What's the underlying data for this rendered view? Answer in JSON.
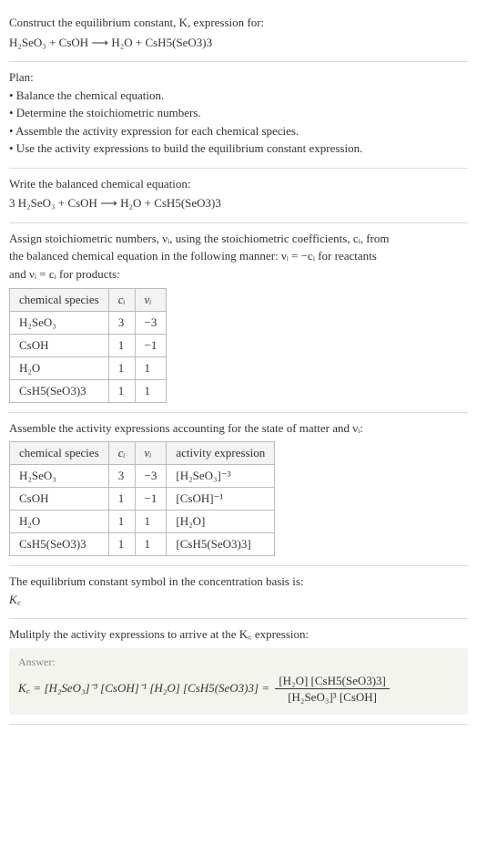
{
  "s1": {
    "title": "Construct the equilibrium constant, K, expression for:",
    "eq": "H₂SeO₃ + CsOH ⟶ H₂O + CsH5(SeO3)3"
  },
  "s2": {
    "title": "Plan:",
    "b1": "• Balance the chemical equation.",
    "b2": "• Determine the stoichiometric numbers.",
    "b3": "• Assemble the activity expression for each chemical species.",
    "b4": "• Use the activity expressions to build the equilibrium constant expression."
  },
  "s3": {
    "title": "Write the balanced chemical equation:",
    "eq": "3 H₂SeO₃ + CsOH ⟶ H₂O + CsH5(SeO3)3"
  },
  "s4": {
    "intro1": "Assign stoichiometric numbers, νᵢ, using the stoichiometric coefficients, cᵢ, from",
    "intro2": "the balanced chemical equation in the following manner: νᵢ = −cᵢ for reactants",
    "intro3": "and νᵢ = cᵢ for products:",
    "h1": "chemical species",
    "h2": "cᵢ",
    "h3": "νᵢ",
    "r1c1": "H₂SeO₃",
    "r1c2": "3",
    "r1c3": "−3",
    "r2c1": "CsOH",
    "r2c2": "1",
    "r2c3": "−1",
    "r3c1": "H₂O",
    "r3c2": "1",
    "r3c3": "1",
    "r4c1": "CsH5(SeO3)3",
    "r4c2": "1",
    "r4c3": "1"
  },
  "s5": {
    "intro": "Assemble the activity expressions accounting for the state of matter and νᵢ:",
    "h1": "chemical species",
    "h2": "cᵢ",
    "h3": "νᵢ",
    "h4": "activity expression",
    "r1c1": "H₂SeO₃",
    "r1c2": "3",
    "r1c3": "−3",
    "r1c4": "[H₂SeO₃]⁻³",
    "r2c1": "CsOH",
    "r2c2": "1",
    "r2c3": "−1",
    "r2c4": "[CsOH]⁻¹",
    "r3c1": "H₂O",
    "r3c2": "1",
    "r3c3": "1",
    "r3c4": "[H₂O]",
    "r4c1": "CsH5(SeO3)3",
    "r4c2": "1",
    "r4c3": "1",
    "r4c4": "[CsH5(SeO3)3]"
  },
  "s6": {
    "l1": "The equilibrium constant symbol in the concentration basis is:",
    "l2": "K꜀"
  },
  "s7": {
    "title": "Mulitply the activity expressions to arrive at the K꜀ expression:",
    "answerlabel": "Answer:",
    "lhs": "K꜀ = [H₂SeO₃]⁻³ [CsOH]⁻¹ [H₂O] [CsH5(SeO3)3] = ",
    "num": "[H₂O] [CsH5(SeO3)3]",
    "den": "[H₂SeO₃]³ [CsOH]"
  },
  "chart_data": {
    "type": "table",
    "tables": [
      {
        "title": "Stoichiometric numbers",
        "columns": [
          "chemical species",
          "c_i",
          "ν_i"
        ],
        "rows": [
          [
            "H2SeO3",
            3,
            -3
          ],
          [
            "CsOH",
            1,
            -1
          ],
          [
            "H2O",
            1,
            1
          ],
          [
            "CsH5(SeO3)3",
            1,
            1
          ]
        ]
      },
      {
        "title": "Activity expressions",
        "columns": [
          "chemical species",
          "c_i",
          "ν_i",
          "activity expression"
        ],
        "rows": [
          [
            "H2SeO3",
            3,
            -3,
            "[H2SeO3]^-3"
          ],
          [
            "CsOH",
            1,
            -1,
            "[CsOH]^-1"
          ],
          [
            "H2O",
            1,
            1,
            "[H2O]"
          ],
          [
            "CsH5(SeO3)3",
            1,
            1,
            "[CsH5(SeO3)3]"
          ]
        ]
      }
    ]
  }
}
